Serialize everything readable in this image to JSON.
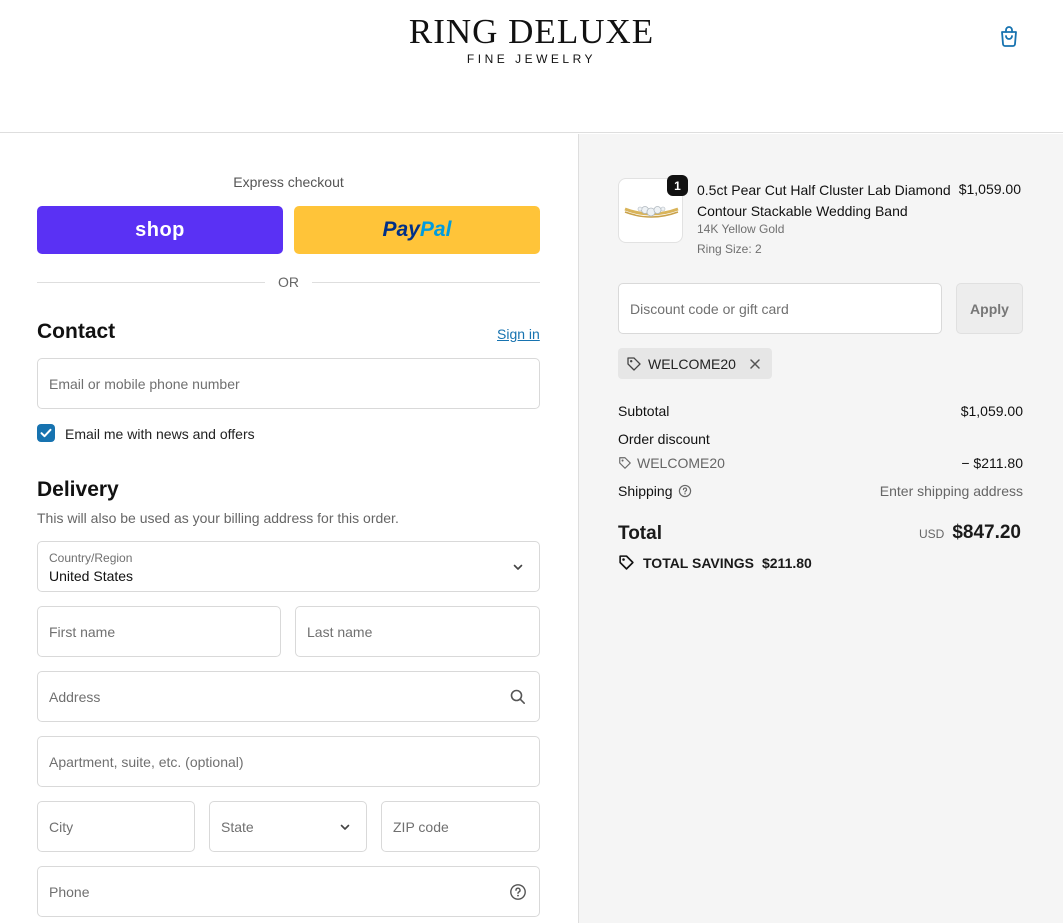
{
  "header": {
    "brand": "RING DELUXE",
    "brand_sub": "FINE JEWELRY",
    "cart_icon": "shopping-bag-icon",
    "accent_color": "#1773b0"
  },
  "express": {
    "label": "Express checkout",
    "shop_label": "shop",
    "paypal_part1": "Pay",
    "paypal_part2": "Pal",
    "or_label": "OR"
  },
  "contact": {
    "title": "Contact",
    "sign_in": "Sign in",
    "email_placeholder": "Email or mobile phone number",
    "newsletter_label": "Email me with news and offers",
    "newsletter_checked": true
  },
  "delivery": {
    "title": "Delivery",
    "subtitle": "This will also be used as your billing address for this order.",
    "country_label": "Country/Region",
    "country_value": "United States",
    "first_name": "First name",
    "last_name": "Last name",
    "address": "Address",
    "apartment": "Apartment, suite, etc. (optional)",
    "city": "City",
    "state": "State",
    "zip": "ZIP code",
    "phone": "Phone"
  },
  "order": {
    "quantity": "1",
    "product_name": "0.5ct Pear Cut Half Cluster Lab Diamond Contour Stackable Wedding Band",
    "variant_metal": "14K Yellow Gold",
    "variant_size": "Ring Size: 2",
    "price": "$1,059.00",
    "discount_placeholder": "Discount code or gift card",
    "apply_label": "Apply",
    "applied_code": "WELCOME20",
    "subtotal_label": "Subtotal",
    "subtotal_value": "$1,059.00",
    "order_discount_label": "Order discount",
    "discount_code": "WELCOME20",
    "discount_value": "− $211.80",
    "shipping_label": "Shipping",
    "shipping_value": "Enter shipping address",
    "total_label": "Total",
    "currency": "USD",
    "total_value": "$847.20",
    "savings_label": "TOTAL SAVINGS",
    "savings_value": "$211.80"
  }
}
